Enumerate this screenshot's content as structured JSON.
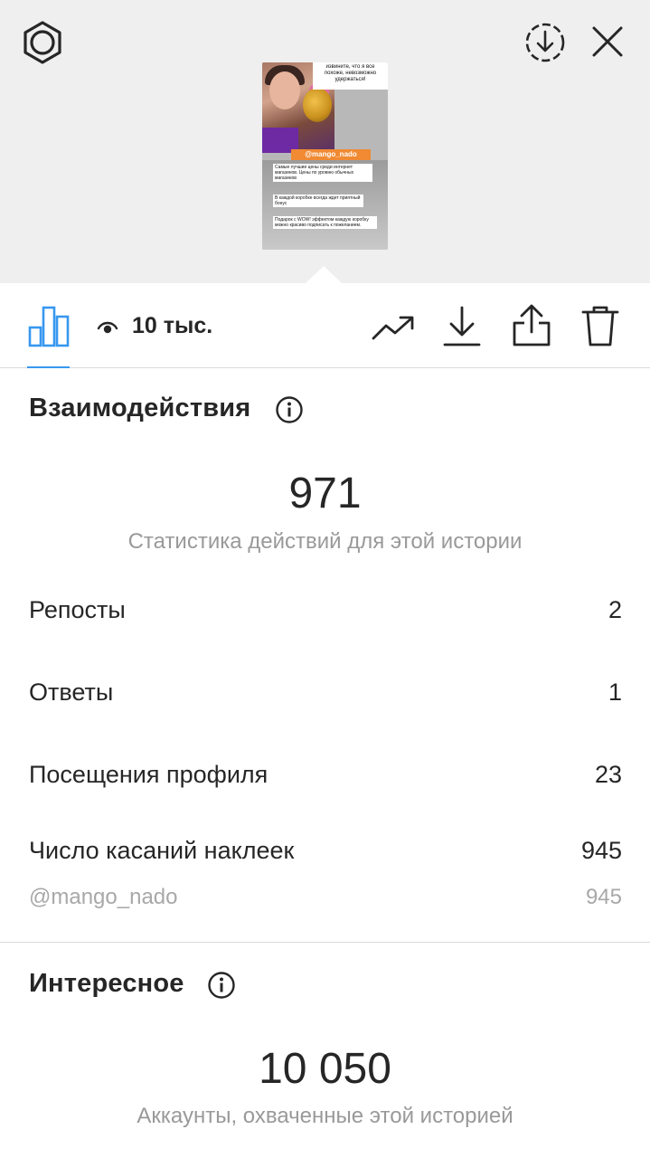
{
  "header": {
    "settings_icon": "gear-icon",
    "save_icon": "download-circle-icon",
    "close_icon": "close-icon"
  },
  "story_preview": {
    "text_top": "извините, что я все похоже, невозможно удержаться!",
    "mention": "@mango_nado",
    "line1": "Самые лучшие цены среди интернет магазинов. Цены по уровню обычных магазинов",
    "line2": "В каждой коробке всегда ждет приятный бонус",
    "line3": "Подарок с WOW! эффектом каждую коробку можно красиво подписать к пожеланием."
  },
  "toolbar": {
    "insights_icon": "bar-chart-icon",
    "views_icon": "eye-icon",
    "views_count": "10 тыс.",
    "promote_icon": "trend-up-icon",
    "download_icon": "download-icon",
    "share_icon": "share-icon",
    "delete_icon": "trash-icon"
  },
  "interactions": {
    "title": "Взаимодействия",
    "total": "971",
    "subtitle": "Статистика действий для этой истории",
    "rows": [
      {
        "label": "Репосты",
        "value": "2"
      },
      {
        "label": "Ответы",
        "value": "1"
      },
      {
        "label": "Посещения профиля",
        "value": "23"
      },
      {
        "label": "Число касаний наклеек",
        "value": "945"
      }
    ],
    "sticker": {
      "label": "@mango_nado",
      "value": "945"
    }
  },
  "discovery": {
    "title": "Интересное",
    "total": "10 050",
    "subtitle": "Аккаунты, охваченные этой историей"
  },
  "colors": {
    "accent": "#3897f0",
    "top_background": "#efefef",
    "mention_tag": "#f08a33"
  }
}
